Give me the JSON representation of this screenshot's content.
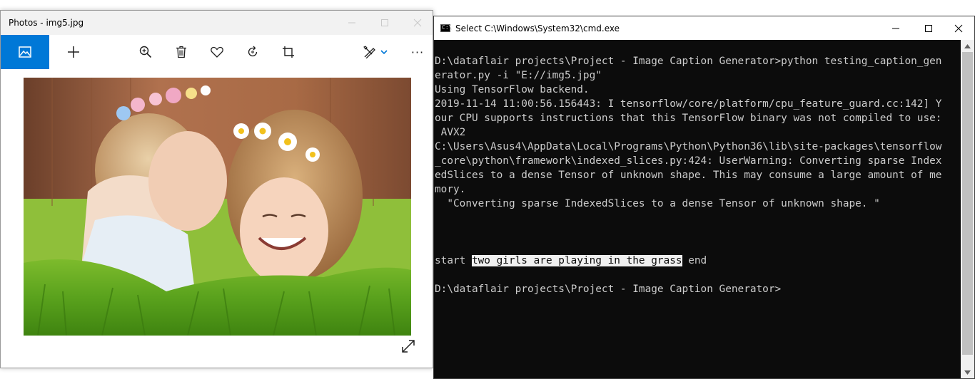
{
  "photos_window": {
    "title": "Photos - img5.jpg",
    "toolbar": {
      "home_icon": "image-icon",
      "add_icon": "plus-icon",
      "zoom_icon": "zoom-in-icon",
      "delete_icon": "trash-icon",
      "favorite_icon": "heart-icon",
      "rotate_icon": "rotate-icon",
      "crop_icon": "crop-icon",
      "edit_icon": "edit-create-icon",
      "more_icon": "more-icon",
      "more_label": "···"
    },
    "expand_icon": "expand-icon",
    "accent_color": "#0078d7"
  },
  "cmd_window": {
    "title": "Select C:\\Windows\\System32\\cmd.exe",
    "icon_glyph": "C:\\",
    "console_lines": [
      "D:\\dataflair projects\\Project - Image Caption Generator>python testing_caption_gen",
      "erator.py -i \"E://img5.jpg\"",
      "Using TensorFlow backend.",
      "2019-11-14 11:00:56.156443: I tensorflow/core/platform/cpu_feature_guard.cc:142] Y",
      "our CPU supports instructions that this TensorFlow binary was not compiled to use:",
      " AVX2",
      "C:\\Users\\Asus4\\AppData\\Local\\Programs\\Python\\Python36\\lib\\site-packages\\tensorflow",
      "_core\\python\\framework\\indexed_slices.py:424: UserWarning: Converting sparse Index",
      "edSlices to a dense Tensor of unknown shape. This may consume a large amount of me",
      "mory.",
      "  \"Converting sparse IndexedSlices to a dense Tensor of unknown shape. \"",
      "",
      "",
      "",
      ""
    ],
    "result_prefix": "start ",
    "result_caption": "two girls are playing in the grass",
    "result_suffix": " end",
    "blank_line": "",
    "prompt": "D:\\dataflair projects\\Project - Image Caption Generator>"
  }
}
